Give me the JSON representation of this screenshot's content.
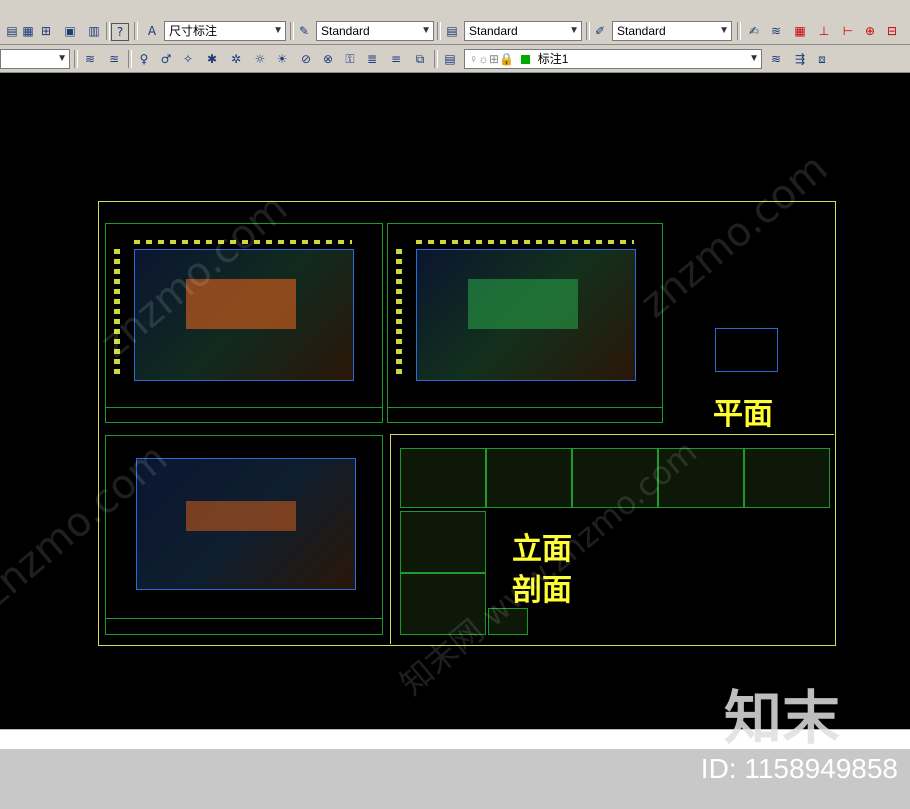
{
  "toolbar_top": {
    "dim_style_label": "尺寸标注",
    "text_style": "Standard",
    "table_style": "Standard",
    "multileader_style": "Standard"
  },
  "toolbar_layer": {
    "layer_name": "标注1"
  },
  "canvas": {
    "label_plan": "平面",
    "label_elevation": "立面",
    "label_section": "剖面"
  },
  "watermark": {
    "text_a": "znzmo.com",
    "text_b": "知末网 www.znzmo.com",
    "brand": "知末",
    "id_text": "ID: 1158949858"
  },
  "colors": {
    "sheet_border": "#d8d85a",
    "label_yellow": "#ffff33",
    "toolbar_bg": "#d4d0c8"
  }
}
